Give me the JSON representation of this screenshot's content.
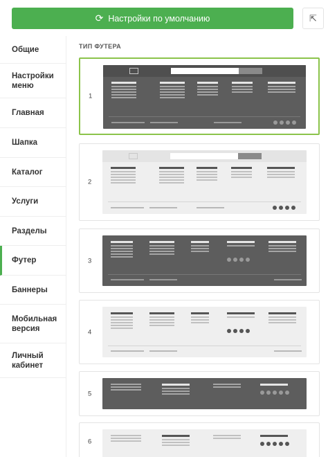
{
  "toolbar": {
    "reset_label": "Настройки по умолчанию",
    "reset_icon": "refresh-icon",
    "share_icon": "share-icon",
    "accent_color": "#4caf50"
  },
  "sidebar": {
    "items": [
      {
        "label": "Общие"
      },
      {
        "label": "Настройки меню"
      },
      {
        "label": "Главная"
      },
      {
        "label": "Шапка"
      },
      {
        "label": "Каталог"
      },
      {
        "label": "Услуги"
      },
      {
        "label": "Разделы"
      },
      {
        "label": "Футер",
        "active": true
      },
      {
        "label": "Баннеры"
      },
      {
        "label": "Мобильная версия"
      },
      {
        "label": "Личный кабинет"
      }
    ]
  },
  "main": {
    "section_title": "ТИП ФУТЕРА",
    "selected_option": "1",
    "options": [
      {
        "number": "1",
        "theme": "dark"
      },
      {
        "number": "2",
        "theme": "light"
      },
      {
        "number": "3",
        "theme": "dark"
      },
      {
        "number": "4",
        "theme": "light"
      },
      {
        "number": "5",
        "theme": "dark"
      },
      {
        "number": "6",
        "theme": "light"
      }
    ]
  }
}
